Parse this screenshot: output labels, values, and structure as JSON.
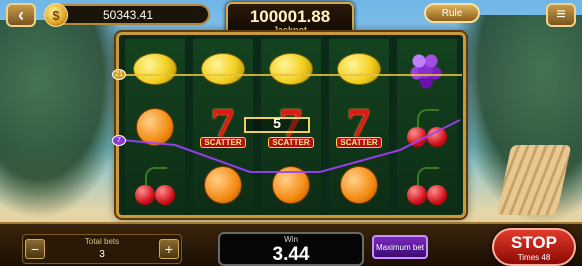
{
  "header": {
    "back_icon": "‹",
    "coin_icon": "$",
    "balance": "50343.41",
    "jackpot_value": "100001.88",
    "jackpot_label": "Jackpot",
    "rule_label": "Rule",
    "menu_icon": "≡"
  },
  "reels": {
    "columns": [
      [
        "lemon",
        "orange",
        "cherry"
      ],
      [
        "lemon",
        "seven-scatter",
        "orange"
      ],
      [
        "lemon",
        "seven-scatter",
        "orange"
      ],
      [
        "lemon",
        "seven-scatter",
        "orange"
      ],
      [
        "grape",
        "cherry",
        "cherry"
      ]
    ],
    "scatter_text": "SCATTER"
  },
  "paylines": {
    "marker_top": "21",
    "marker_mid": "7",
    "win_count": "5",
    "colors": {
      "line21": "#e9c040",
      "line7": "#a040ff"
    }
  },
  "footer": {
    "total_bets_label": "Total bets",
    "total_bets_value": "3",
    "minus_label": "−",
    "plus_label": "+",
    "win_label": "Win",
    "win_value": "3.44",
    "max_bet_label": "Maximum bet",
    "stop_label": "STOP",
    "times_label": "Times 48"
  }
}
